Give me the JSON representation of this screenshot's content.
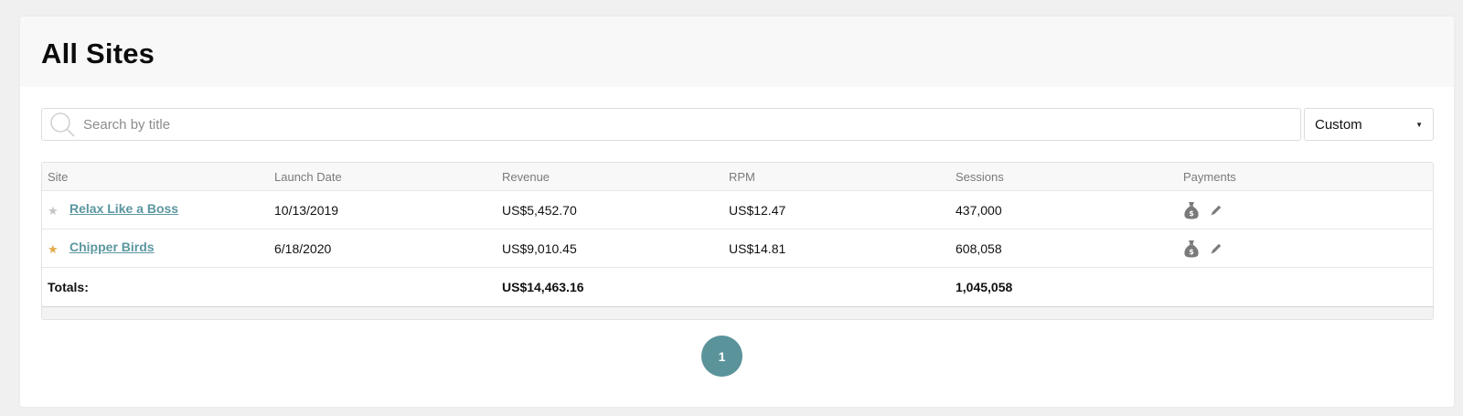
{
  "header": {
    "title": "All Sites"
  },
  "search": {
    "placeholder": "Search by title",
    "value": ""
  },
  "period_select": {
    "selected": "Custom"
  },
  "table": {
    "columns": [
      "Site",
      "Launch Date",
      "Revenue",
      "RPM",
      "Sessions",
      "Payments"
    ],
    "rows": [
      {
        "starred": false,
        "site": "Relax Like a Boss",
        "launch_date": "10/13/2019",
        "revenue": "US$5,452.70",
        "rpm": "US$12.47",
        "sessions": "437,000"
      },
      {
        "starred": true,
        "site": "Chipper Birds",
        "launch_date": "6/18/2020",
        "revenue": "US$9,010.45",
        "rpm": "US$14.81",
        "sessions": "608,058"
      }
    ],
    "totals": {
      "label": "Totals:",
      "revenue": "US$14,463.16",
      "sessions": "1,045,058"
    }
  },
  "pagination": {
    "current_page": "1"
  },
  "colors": {
    "accent": "#5b939b",
    "link": "#5b97a0",
    "star_active": "#e3a94b",
    "star_inactive": "#c4c4c4",
    "icon_gray": "#7a7a7a"
  },
  "icons": {
    "search": "search-icon",
    "select": "caret-down-icon",
    "star": "star-icon",
    "payment": "money-bag-icon",
    "edit": "pencil-icon"
  }
}
